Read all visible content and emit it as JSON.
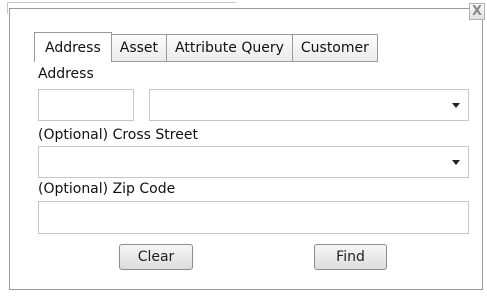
{
  "window": {
    "close_label": "X"
  },
  "tabs": [
    {
      "label": "Address",
      "active": true
    },
    {
      "label": "Asset",
      "active": false
    },
    {
      "label": "Attribute Query",
      "active": false
    },
    {
      "label": "Customer",
      "active": false
    }
  ],
  "form": {
    "address_label": "Address",
    "address_number_value": "",
    "address_street_value": "",
    "cross_street_label": "(Optional) Cross Street",
    "cross_street_value": "",
    "zip_label": "(Optional) Zip Code",
    "zip_value": ""
  },
  "buttons": {
    "clear_label": "Clear",
    "find_label": "Find"
  }
}
